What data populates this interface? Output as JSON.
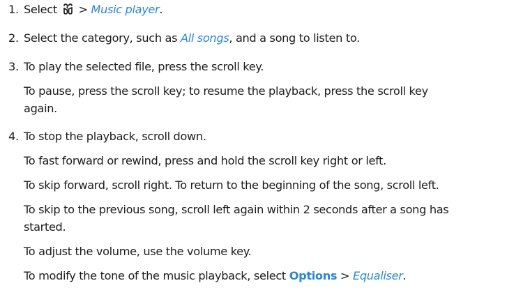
{
  "steps": [
    {
      "number": "1.",
      "prefix": "Select",
      "icon": "menu-key-icon",
      "separator": ">",
      "link": "Music player",
      "suffix": "."
    },
    {
      "number": "2.",
      "prefix": "Select the category, such as",
      "link": "All songs",
      "suffix": ", and a song to listen to."
    },
    {
      "number": "3.",
      "text": "To play the selected file, press the scroll key.",
      "sub_lines": [
        "To pause, press the scroll key; to resume the playback, press the scroll key",
        "again."
      ]
    },
    {
      "number": "4.",
      "text": "To stop the playback, scroll down.",
      "sub_lines": [
        "To fast forward or rewind, press and hold the scroll key right or left.",
        "To skip forward, scroll right. To return to the beginning of the song, scroll left.",
        "To skip to the previous song, scroll left again within 2 seconds after a song has",
        "started.",
        "To adjust the volume, use the volume key."
      ],
      "last_prefix": "To modify the tone of the music playback, select",
      "last_option": "Options",
      "last_separator": ">",
      "last_link": "Equaliser",
      "last_suffix": "."
    }
  ],
  "colors": {
    "link": "#2a87d0",
    "text": "#1c1c1c"
  }
}
